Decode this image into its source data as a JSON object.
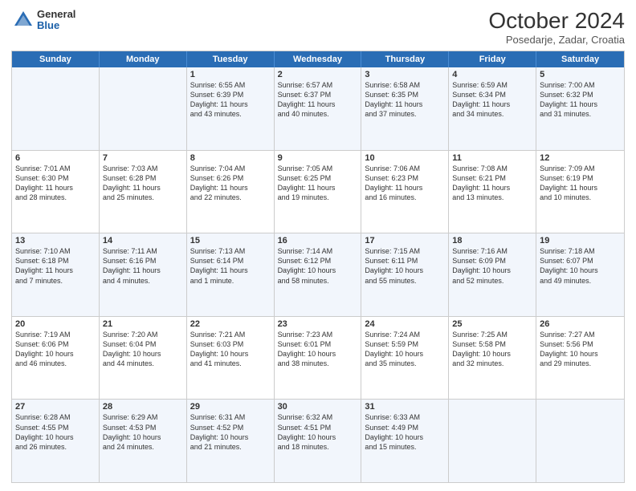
{
  "logo": {
    "general": "General",
    "blue": "Blue"
  },
  "title": "October 2024",
  "subtitle": "Posedarje, Zadar, Croatia",
  "days": [
    "Sunday",
    "Monday",
    "Tuesday",
    "Wednesday",
    "Thursday",
    "Friday",
    "Saturday"
  ],
  "rows": [
    [
      {
        "day": "",
        "text": ""
      },
      {
        "day": "",
        "text": ""
      },
      {
        "day": "1",
        "text": "Sunrise: 6:55 AM\nSunset: 6:39 PM\nDaylight: 11 hours\nand 43 minutes."
      },
      {
        "day": "2",
        "text": "Sunrise: 6:57 AM\nSunset: 6:37 PM\nDaylight: 11 hours\nand 40 minutes."
      },
      {
        "day": "3",
        "text": "Sunrise: 6:58 AM\nSunset: 6:35 PM\nDaylight: 11 hours\nand 37 minutes."
      },
      {
        "day": "4",
        "text": "Sunrise: 6:59 AM\nSunset: 6:34 PM\nDaylight: 11 hours\nand 34 minutes."
      },
      {
        "day": "5",
        "text": "Sunrise: 7:00 AM\nSunset: 6:32 PM\nDaylight: 11 hours\nand 31 minutes."
      }
    ],
    [
      {
        "day": "6",
        "text": "Sunrise: 7:01 AM\nSunset: 6:30 PM\nDaylight: 11 hours\nand 28 minutes."
      },
      {
        "day": "7",
        "text": "Sunrise: 7:03 AM\nSunset: 6:28 PM\nDaylight: 11 hours\nand 25 minutes."
      },
      {
        "day": "8",
        "text": "Sunrise: 7:04 AM\nSunset: 6:26 PM\nDaylight: 11 hours\nand 22 minutes."
      },
      {
        "day": "9",
        "text": "Sunrise: 7:05 AM\nSunset: 6:25 PM\nDaylight: 11 hours\nand 19 minutes."
      },
      {
        "day": "10",
        "text": "Sunrise: 7:06 AM\nSunset: 6:23 PM\nDaylight: 11 hours\nand 16 minutes."
      },
      {
        "day": "11",
        "text": "Sunrise: 7:08 AM\nSunset: 6:21 PM\nDaylight: 11 hours\nand 13 minutes."
      },
      {
        "day": "12",
        "text": "Sunrise: 7:09 AM\nSunset: 6:19 PM\nDaylight: 11 hours\nand 10 minutes."
      }
    ],
    [
      {
        "day": "13",
        "text": "Sunrise: 7:10 AM\nSunset: 6:18 PM\nDaylight: 11 hours\nand 7 minutes."
      },
      {
        "day": "14",
        "text": "Sunrise: 7:11 AM\nSunset: 6:16 PM\nDaylight: 11 hours\nand 4 minutes."
      },
      {
        "day": "15",
        "text": "Sunrise: 7:13 AM\nSunset: 6:14 PM\nDaylight: 11 hours\nand 1 minute."
      },
      {
        "day": "16",
        "text": "Sunrise: 7:14 AM\nSunset: 6:12 PM\nDaylight: 10 hours\nand 58 minutes."
      },
      {
        "day": "17",
        "text": "Sunrise: 7:15 AM\nSunset: 6:11 PM\nDaylight: 10 hours\nand 55 minutes."
      },
      {
        "day": "18",
        "text": "Sunrise: 7:16 AM\nSunset: 6:09 PM\nDaylight: 10 hours\nand 52 minutes."
      },
      {
        "day": "19",
        "text": "Sunrise: 7:18 AM\nSunset: 6:07 PM\nDaylight: 10 hours\nand 49 minutes."
      }
    ],
    [
      {
        "day": "20",
        "text": "Sunrise: 7:19 AM\nSunset: 6:06 PM\nDaylight: 10 hours\nand 46 minutes."
      },
      {
        "day": "21",
        "text": "Sunrise: 7:20 AM\nSunset: 6:04 PM\nDaylight: 10 hours\nand 44 minutes."
      },
      {
        "day": "22",
        "text": "Sunrise: 7:21 AM\nSunset: 6:03 PM\nDaylight: 10 hours\nand 41 minutes."
      },
      {
        "day": "23",
        "text": "Sunrise: 7:23 AM\nSunset: 6:01 PM\nDaylight: 10 hours\nand 38 minutes."
      },
      {
        "day": "24",
        "text": "Sunrise: 7:24 AM\nSunset: 5:59 PM\nDaylight: 10 hours\nand 35 minutes."
      },
      {
        "day": "25",
        "text": "Sunrise: 7:25 AM\nSunset: 5:58 PM\nDaylight: 10 hours\nand 32 minutes."
      },
      {
        "day": "26",
        "text": "Sunrise: 7:27 AM\nSunset: 5:56 PM\nDaylight: 10 hours\nand 29 minutes."
      }
    ],
    [
      {
        "day": "27",
        "text": "Sunrise: 6:28 AM\nSunset: 4:55 PM\nDaylight: 10 hours\nand 26 minutes."
      },
      {
        "day": "28",
        "text": "Sunrise: 6:29 AM\nSunset: 4:53 PM\nDaylight: 10 hours\nand 24 minutes."
      },
      {
        "day": "29",
        "text": "Sunrise: 6:31 AM\nSunset: 4:52 PM\nDaylight: 10 hours\nand 21 minutes."
      },
      {
        "day": "30",
        "text": "Sunrise: 6:32 AM\nSunset: 4:51 PM\nDaylight: 10 hours\nand 18 minutes."
      },
      {
        "day": "31",
        "text": "Sunrise: 6:33 AM\nSunset: 4:49 PM\nDaylight: 10 hours\nand 15 minutes."
      },
      {
        "day": "",
        "text": ""
      },
      {
        "day": "",
        "text": ""
      }
    ]
  ],
  "alt_rows": [
    0,
    2,
    4
  ]
}
